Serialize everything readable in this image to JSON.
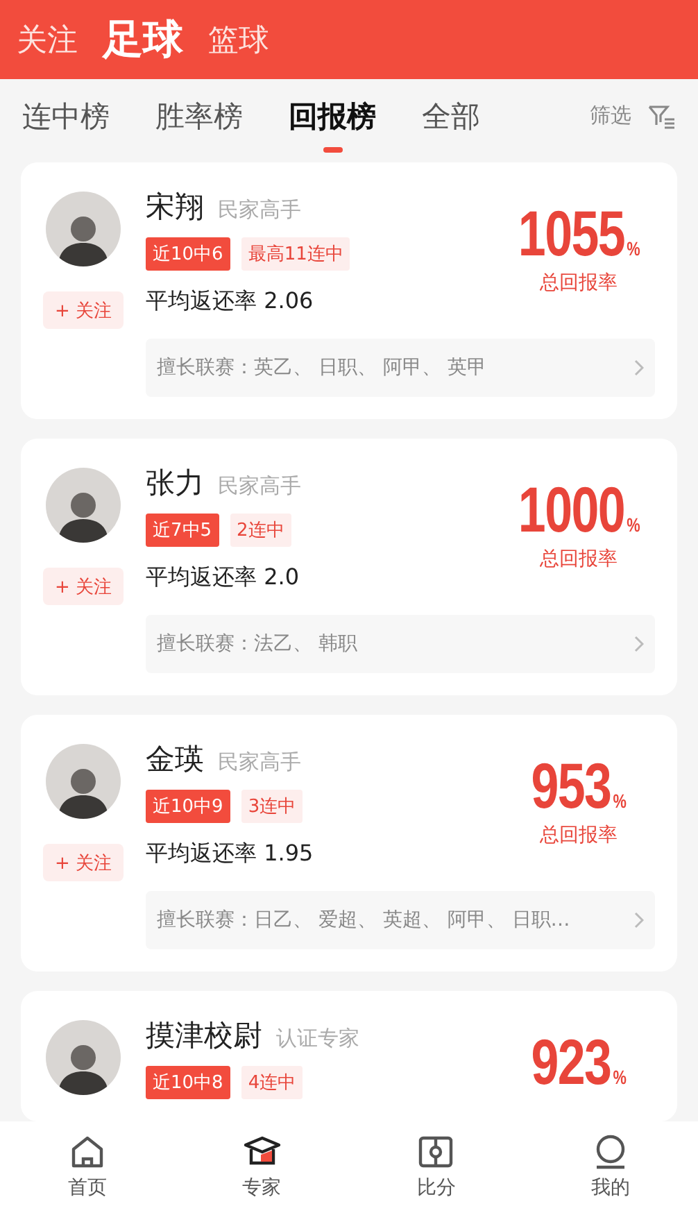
{
  "top_tabs": [
    {
      "label": "关注",
      "selected": false
    },
    {
      "label": "足球",
      "selected": true
    },
    {
      "label": "篮球",
      "selected": false
    }
  ],
  "sub_tabs": [
    {
      "label": "连中榜",
      "selected": false
    },
    {
      "label": "胜率榜",
      "selected": false
    },
    {
      "label": "回报榜",
      "selected": true
    },
    {
      "label": "全部",
      "selected": false
    }
  ],
  "filter": {
    "label": "筛选"
  },
  "experts": [
    {
      "name": "宋翔",
      "title": "民家高手",
      "follow": "+ 关注",
      "tags": [
        {
          "text": "近10中6",
          "kind": "solid"
        },
        {
          "text": "最高11连中",
          "kind": "light"
        }
      ],
      "avg": "平均返还率 2.06",
      "leagues": "擅长联赛：英乙、 日职、 阿甲、 英甲",
      "rate": "1055",
      "unit": "%",
      "rate_label": "总回报率"
    },
    {
      "name": "张力",
      "title": "民家高手",
      "follow": "+ 关注",
      "tags": [
        {
          "text": "近7中5",
          "kind": "solid"
        },
        {
          "text": "2连中",
          "kind": "light"
        }
      ],
      "avg": "平均返还率 2.0",
      "leagues": "擅长联赛：法乙、 韩职",
      "rate": "1000",
      "unit": "%",
      "rate_label": "总回报率"
    },
    {
      "name": "金瑛",
      "title": "民家高手",
      "follow": "+ 关注",
      "tags": [
        {
          "text": "近10中9",
          "kind": "solid"
        },
        {
          "text": "3连中",
          "kind": "light"
        }
      ],
      "avg": "平均返还率 1.95",
      "leagues": "擅长联赛：日乙、 爱超、 英超、 阿甲、 日职…",
      "rate": "953",
      "unit": "%",
      "rate_label": "总回报率"
    },
    {
      "name": "摸津校尉",
      "title": "认证专家",
      "tags": [
        {
          "text": "近10中8",
          "kind": "solid"
        },
        {
          "text": "4连中",
          "kind": "light"
        }
      ],
      "rate": "923",
      "unit": "%"
    }
  ],
  "nav": [
    {
      "label": "首页",
      "kind": "home",
      "selected": false
    },
    {
      "label": "专家",
      "kind": "expert",
      "selected": true
    },
    {
      "label": "比分",
      "kind": "score",
      "selected": false
    },
    {
      "label": "我的",
      "kind": "me",
      "selected": false
    }
  ]
}
